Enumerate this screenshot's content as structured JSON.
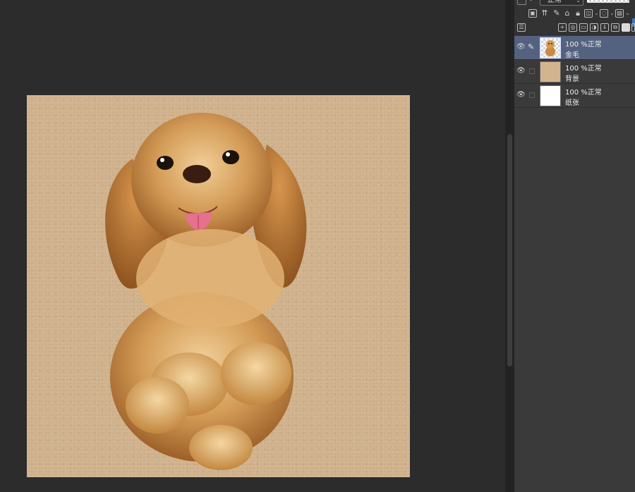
{
  "panel": {
    "blend_mode": "正常",
    "edge_value": "1",
    "layers": [
      {
        "opacity": "100",
        "mode": "%正常",
        "name": "金毛",
        "thumb": "dog-thumbnail",
        "selected": true
      },
      {
        "opacity": "100",
        "mode": "%正常",
        "name": "背景",
        "thumb": "tan-swatch",
        "selected": false
      },
      {
        "opacity": "100",
        "mode": "%正常",
        "name": "纸张",
        "thumb": "white-swatch",
        "selected": false
      }
    ]
  },
  "icons": [
    "layer-box-icon",
    "blend-dropdown-icon",
    "new-raster-layer-icon",
    "new-vector-layer-icon",
    "new-folder-icon",
    "lock-icon",
    "clip-icon",
    "reference-icon",
    "mask-icon",
    "eye-icon",
    "pen-icon"
  ],
  "colors": {
    "workspace": "#2c2c2c",
    "canvas_paper": "#d2b48f",
    "panel": "#3a3a3a",
    "selected_layer": "#55627f",
    "accent": "#3f79c9",
    "dog_fur": "#c88a45"
  }
}
